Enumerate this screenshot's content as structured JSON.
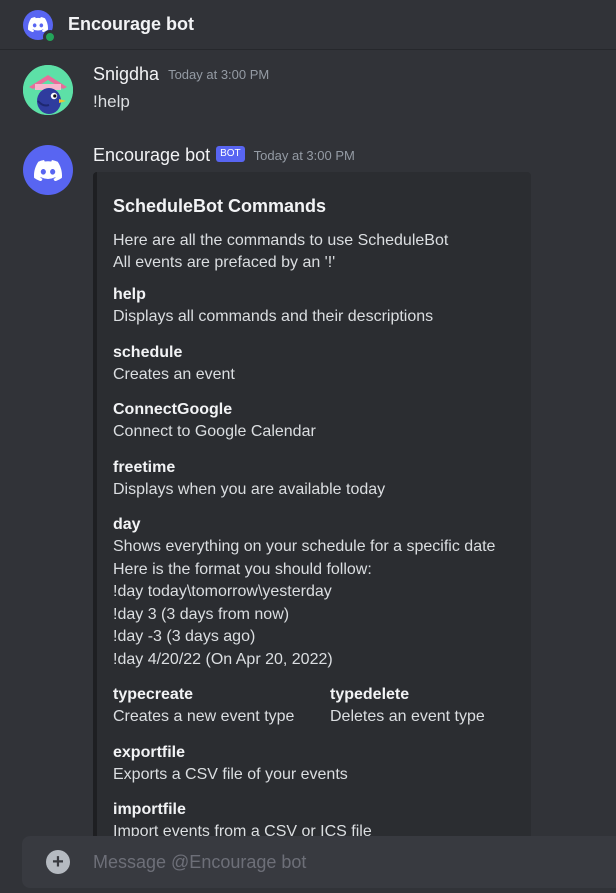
{
  "header": {
    "title": "Encourage bot",
    "avatar_icon": "discord-logo-icon",
    "status_color": "#23a55a"
  },
  "messages": [
    {
      "author": "Snigdha",
      "timestamp": "Today at 3:00 PM",
      "text": "!help",
      "avatar_icon": "bird-avatar-icon"
    },
    {
      "author": "Encourage bot",
      "badge": "BOT",
      "timestamp": "Today at 3:00 PM",
      "avatar_icon": "discord-logo-icon",
      "embed": {
        "title": "ScheduleBot Commands",
        "description_lines": [
          "Here are all the commands to use ScheduleBot",
          "All events are prefaced by an '!'"
        ],
        "fields": [
          {
            "name": "help",
            "value_lines": [
              "Displays all commands and their descriptions"
            ]
          },
          {
            "name": "schedule",
            "value_lines": [
              "Creates an event"
            ]
          },
          {
            "name": "ConnectGoogle",
            "value_lines": [
              "Connect to Google Calendar"
            ]
          },
          {
            "name": "freetime",
            "value_lines": [
              "Displays when you are available today"
            ]
          },
          {
            "name": "day",
            "value_lines": [
              "Shows everything on your schedule for a specific date",
              "Here is the format you should follow:",
              "!day today\\tomorrow\\yesterday",
              "!day 3 (3 days from now)",
              "!day -3 (3 days ago)",
              "!day 4/20/22 (On Apr 20, 2022)"
            ]
          },
          {
            "name": "typecreate",
            "value_lines": [
              "Creates a new event type"
            ]
          },
          {
            "name": "typedelete",
            "value_lines": [
              "Deletes an event type"
            ]
          },
          {
            "name": "exportfile",
            "value_lines": [
              "Exports a CSV file of your events"
            ]
          },
          {
            "name": "importfile",
            "value_lines": [
              "Import events from a CSV or ICS file"
            ]
          }
        ]
      }
    }
  ],
  "composer": {
    "placeholder": "Message @Encourage bot",
    "plus_icon": "plus-circle-icon"
  }
}
